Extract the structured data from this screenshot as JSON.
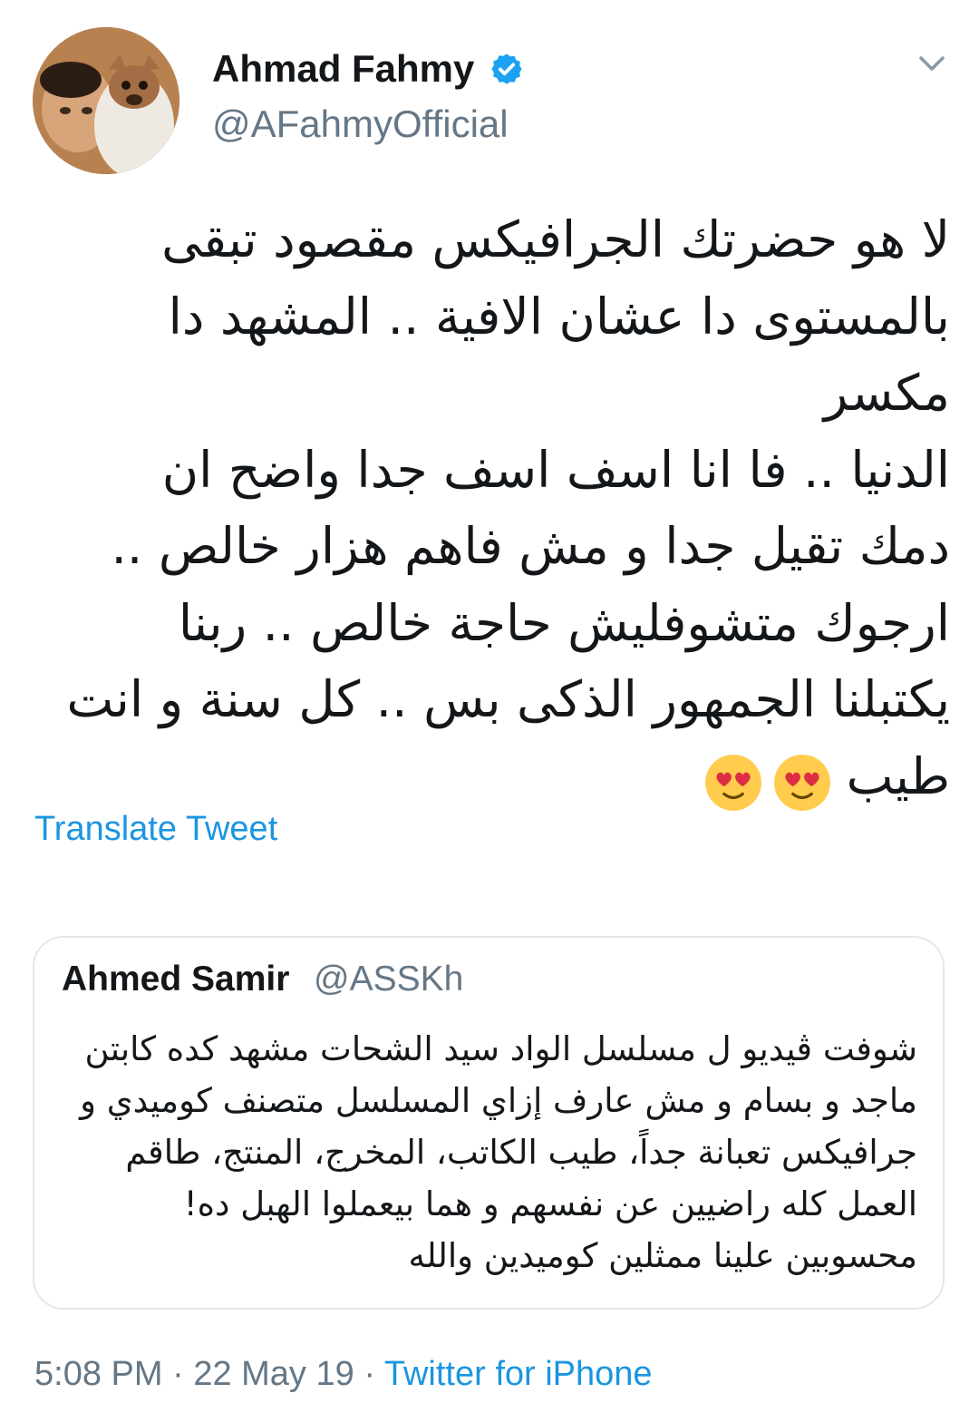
{
  "author": {
    "display_name": "Ahmad Fahmy",
    "handle": "@AFahmyOfficial",
    "verified": true
  },
  "tweet": {
    "text": "لا هو حضرتك الجرافيكس مقصود تبقى\nبالمستوى دا عشان الافية .. المشهد دا مكسر\nالدنيا .. فا انا اسف اسف جدا واضح ان\nدمك تقيل جدا و مش فاهم هزار خالص ..\nارجوك متشوفليش حاجة خالص .. ربنا\nيكتبلنا الجمهور الذكى بس .. كل سنة و انت\nطيب",
    "emojis": [
      "heart-eyes-emoji",
      "heart-eyes-emoji"
    ]
  },
  "translate_label": "Translate Tweet",
  "quoted_tweet": {
    "display_name": "Ahmed Samir",
    "handle": "@ASSKh",
    "text": "شوفت ڤيديو ل مسلسل الواد سيد الشحات مشهد كده كابتن\nماجد و بسام و مش عارف إزاي المسلسل متصنف كوميدي و\nجرافيكس تعبانة جداً، طيب الكاتب، المخرج، المنتج، طاقم\nالعمل كله راضيين عن نفسهم و هما بيعملوا الهبل ده!\nمحسوبين علينا ممثلين كوميدين والله"
  },
  "meta": {
    "time": "5:08 PM",
    "separator": " · ",
    "date": "22 May 19",
    "source": "Twitter for iPhone"
  },
  "colors": {
    "link": "#1b95e0",
    "secondary_text": "#657786",
    "border": "#e1e8ed",
    "verified": "#1da1f2"
  }
}
